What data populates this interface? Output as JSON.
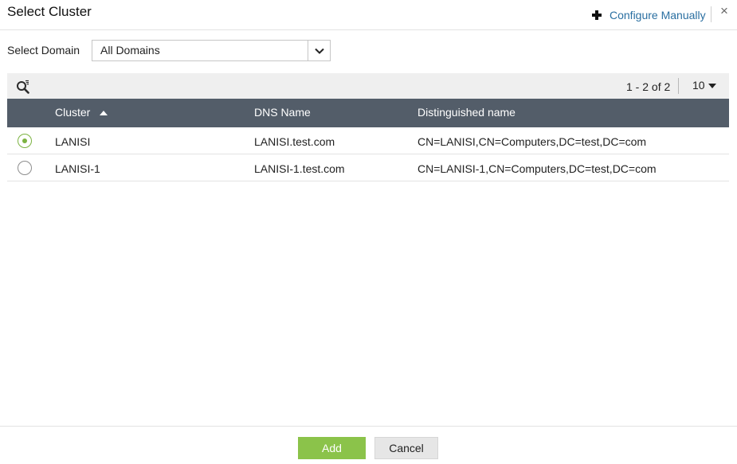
{
  "dialog": {
    "title": "Select Cluster",
    "configure_label": "Configure Manually",
    "close_glyph": "×"
  },
  "domain": {
    "label": "Select Domain",
    "selected": "All Domains"
  },
  "toolbar": {
    "pager_text": "1 - 2 of 2",
    "page_size": "10"
  },
  "grid": {
    "columns": [
      "Cluster",
      "DNS Name",
      "Distinguished name"
    ],
    "sorted_column": "Cluster",
    "sort_direction": "ascending",
    "rows": [
      {
        "cluster": "LANISI",
        "dns": "LANISI.test.com",
        "dn": "CN=LANISI,CN=Computers,DC=test,DC=com",
        "selected": true
      },
      {
        "cluster": "LANISI-1",
        "dns": "LANISI-1.test.com",
        "dn": "CN=LANISI-1,CN=Computers,DC=test,DC=com",
        "selected": false
      }
    ]
  },
  "footer": {
    "add_label": "Add",
    "cancel_label": "Cancel"
  },
  "colors": {
    "grid_header": "#535d69",
    "accent_green": "#8bc34a",
    "link_blue": "#2a6fa1"
  },
  "icons": {
    "configure": "plus-icon",
    "close": "close-icon",
    "search": "search-filter-icon",
    "dropdown": "chevron-down-icon",
    "sort": "sort-ascending-icon",
    "page_size": "caret-down-icon"
  }
}
